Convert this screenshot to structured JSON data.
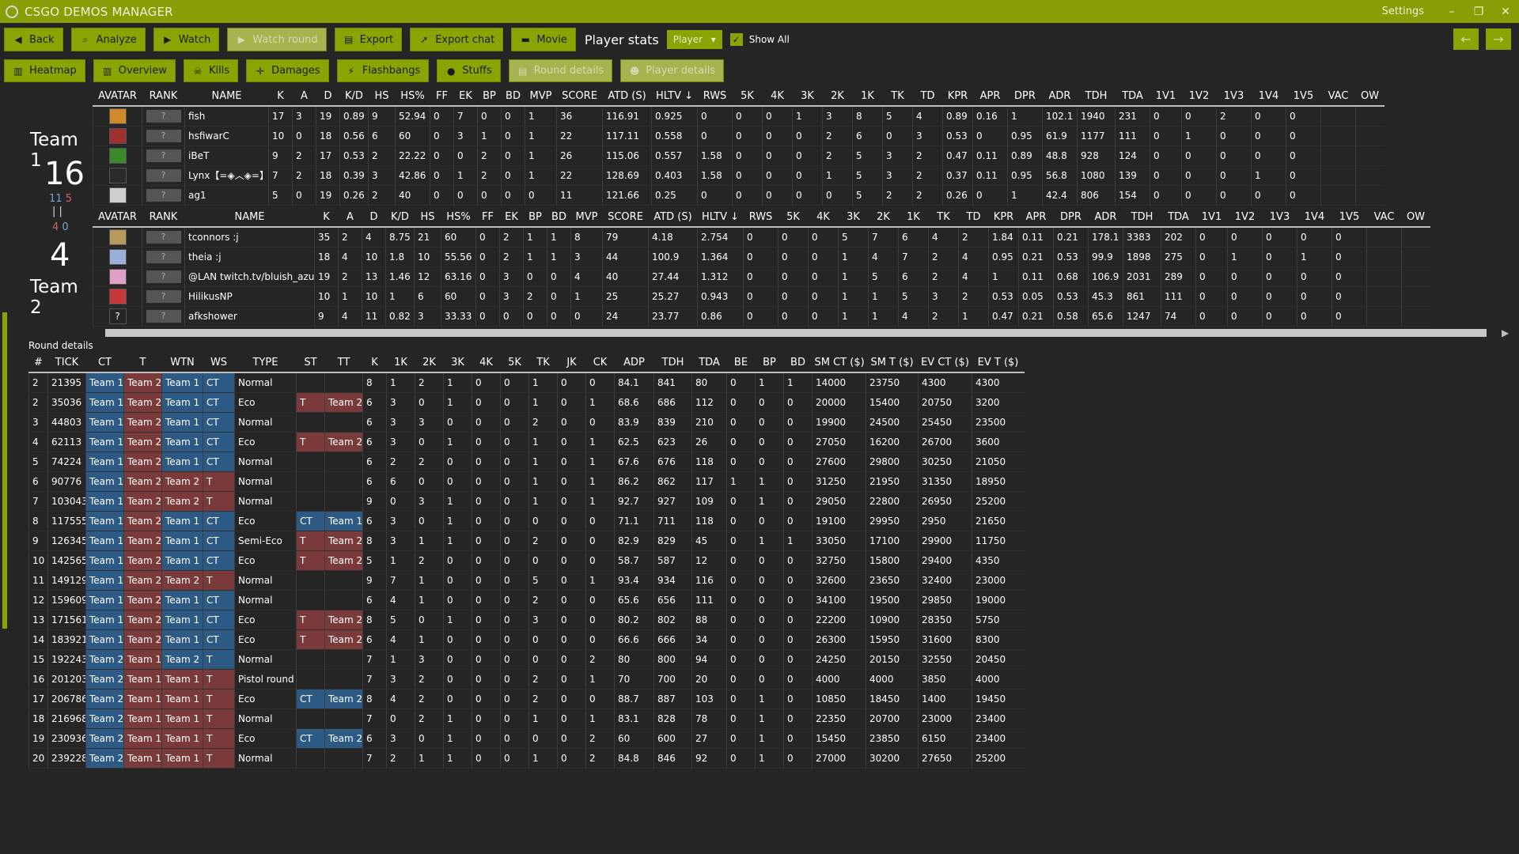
{
  "app": {
    "title": "CSGO DEMOS MANAGER",
    "settings": "Settings",
    "win_min": "–",
    "win_max": "❐",
    "win_close": "✕"
  },
  "toolbar1": {
    "back": "Back",
    "analyze": "Analyze",
    "watch": "Watch",
    "watch_round": "Watch round",
    "export": "Export",
    "export_chat": "Export chat",
    "movie": "Movie",
    "player_stats": "Player stats",
    "player_select": "Player",
    "show_all": "Show All"
  },
  "toolbar2": {
    "heatmap": "Heatmap",
    "overview": "Overview",
    "kills": "Kills",
    "damages": "Damages",
    "flashbangs": "Flashbangs",
    "stuffs": "Stuffs",
    "round_details": "Round details",
    "player_details": "Player details"
  },
  "team1": {
    "name": "Team 1",
    "score": "16",
    "half_a": "11",
    "half_b": "5",
    "half_c": "4",
    "half_d": "0"
  },
  "team2": {
    "name": "Team 2",
    "score": "4"
  },
  "player_headers": [
    "AVATAR",
    "RANK",
    "NAME",
    "K",
    "A",
    "D",
    "K/D",
    "HS",
    "HS%",
    "FF",
    "EK",
    "BP",
    "BD",
    "MVP",
    "SCORE",
    "ATD (S)",
    "HLTV ↓",
    "RWS",
    "5K",
    "4K",
    "3K",
    "2K",
    "1K",
    "TK",
    "TD",
    "KPR",
    "APR",
    "DPR",
    "ADR",
    "TDH",
    "TDA",
    "1V1",
    "1V2",
    "1V3",
    "1V4",
    "1V5",
    "VAC",
    "OW"
  ],
  "rank_placeholder": "?",
  "team1_players": [
    {
      "avatar_color": "#d08a2a",
      "cells": [
        "fish",
        "17",
        "3",
        "19",
        "0.89",
        "9",
        "52.94",
        "0",
        "7",
        "0",
        "0",
        "1",
        "36",
        "116.91",
        "0.925",
        "0",
        "0",
        "0",
        "1",
        "3",
        "8",
        "5",
        "4",
        "0.89",
        "0.16",
        "1",
        "102.1",
        "1940",
        "231",
        "0",
        "0",
        "2",
        "0",
        "0",
        "",
        ""
      ]
    },
    {
      "avatar_color": "#a03030",
      "cells": [
        "hsfiwarC",
        "10",
        "0",
        "18",
        "0.56",
        "6",
        "60",
        "0",
        "3",
        "1",
        "0",
        "1",
        "22",
        "117.11",
        "0.558",
        "0",
        "0",
        "0",
        "0",
        "2",
        "6",
        "0",
        "3",
        "0.53",
        "0",
        "0.95",
        "61.9",
        "1177",
        "111",
        "0",
        "1",
        "0",
        "0",
        "0",
        "",
        ""
      ]
    },
    {
      "avatar_color": "#3a8a2a",
      "cells": [
        "iBeT",
        "9",
        "2",
        "17",
        "0.53",
        "2",
        "22.22",
        "0",
        "0",
        "2",
        "0",
        "1",
        "26",
        "115.06",
        "0.557",
        "1.58",
        "0",
        "0",
        "0",
        "2",
        "5",
        "3",
        "2",
        "0.47",
        "0.11",
        "0.89",
        "48.8",
        "928",
        "124",
        "0",
        "0",
        "0",
        "0",
        "0",
        "",
        ""
      ]
    },
    {
      "avatar_color": "#2a2a2a",
      "cells": [
        "Lynx【=◈︿◈=】",
        "7",
        "2",
        "18",
        "0.39",
        "3",
        "42.86",
        "0",
        "1",
        "2",
        "0",
        "1",
        "22",
        "128.69",
        "0.403",
        "1.58",
        "0",
        "0",
        "0",
        "1",
        "5",
        "3",
        "2",
        "0.37",
        "0.11",
        "0.95",
        "56.8",
        "1080",
        "139",
        "0",
        "0",
        "0",
        "1",
        "0",
        "",
        ""
      ]
    },
    {
      "avatar_color": "#cfcfcf",
      "cells": [
        "ag1",
        "5",
        "0",
        "19",
        "0.26",
        "2",
        "40",
        "0",
        "0",
        "0",
        "0",
        "0",
        "11",
        "121.66",
        "0.25",
        "0",
        "0",
        "0",
        "0",
        "0",
        "5",
        "2",
        "2",
        "0.26",
        "0",
        "1",
        "42.4",
        "806",
        "154",
        "0",
        "0",
        "0",
        "0",
        "0",
        "",
        ""
      ]
    }
  ],
  "team2_players": [
    {
      "avatar_color": "#b89a5a",
      "cells": [
        "tconnors :j",
        "35",
        "2",
        "4",
        "8.75",
        "21",
        "60",
        "0",
        "2",
        "1",
        "1",
        "8",
        "79",
        "4.18",
        "2.754",
        "0",
        "0",
        "0",
        "5",
        "7",
        "6",
        "4",
        "2",
        "1.84",
        "0.11",
        "0.21",
        "178.1",
        "3383",
        "202",
        "0",
        "0",
        "0",
        "0",
        "0",
        "",
        ""
      ]
    },
    {
      "avatar_color": "#9ab0d8",
      "cells": [
        "theia :j",
        "18",
        "4",
        "10",
        "1.8",
        "10",
        "55.56",
        "0",
        "2",
        "1",
        "1",
        "3",
        "44",
        "100.9",
        "1.364",
        "0",
        "0",
        "0",
        "1",
        "4",
        "7",
        "2",
        "4",
        "0.95",
        "0.21",
        "0.53",
        "99.9",
        "1898",
        "275",
        "0",
        "1",
        "0",
        "1",
        "0",
        "",
        ""
      ]
    },
    {
      "avatar_color": "#e0a0c8",
      "cells": [
        "@LAN twitch.tv/bluish_azul",
        "19",
        "2",
        "13",
        "1.46",
        "12",
        "63.16",
        "0",
        "3",
        "0",
        "0",
        "4",
        "40",
        "27.44",
        "1.312",
        "0",
        "0",
        "0",
        "1",
        "5",
        "6",
        "2",
        "4",
        "1",
        "0.11",
        "0.68",
        "106.9",
        "2031",
        "289",
        "0",
        "0",
        "0",
        "0",
        "0",
        "",
        ""
      ]
    },
    {
      "avatar_color": "#c83838",
      "cells": [
        "HilikusNP",
        "10",
        "1",
        "10",
        "1",
        "6",
        "60",
        "0",
        "3",
        "2",
        "0",
        "1",
        "25",
        "25.27",
        "0.943",
        "0",
        "0",
        "0",
        "1",
        "1",
        "5",
        "3",
        "2",
        "0.53",
        "0.05",
        "0.53",
        "45.3",
        "861",
        "111",
        "0",
        "0",
        "0",
        "0",
        "0",
        "",
        ""
      ]
    },
    {
      "avatar_color": "#252526",
      "avatar_text": "?",
      "cells": [
        "afkshower",
        "9",
        "4",
        "11",
        "0.82",
        "3",
        "33.33",
        "0",
        "0",
        "0",
        "0",
        "0",
        "24",
        "23.77",
        "0.86",
        "0",
        "0",
        "0",
        "1",
        "1",
        "4",
        "2",
        "1",
        "0.47",
        "0.21",
        "0.58",
        "65.6",
        "1247",
        "74",
        "0",
        "0",
        "0",
        "0",
        "0",
        "",
        ""
      ]
    }
  ],
  "round_details_title": "Round details",
  "round_headers": [
    "#",
    "TICK",
    "CT",
    "T",
    "WTN",
    "WS",
    "TYPE",
    "ST",
    "TT",
    "K",
    "1K",
    "2K",
    "3K",
    "4K",
    "5K",
    "TK",
    "JK",
    "CK",
    "ADP",
    "TDH",
    "TDA",
    "BE",
    "BP",
    "BD",
    "SM CT ($)",
    "SM T ($)",
    "EV CT ($)",
    "EV T ($)"
  ],
  "rounds": [
    [
      "2",
      "21395",
      "Team 1",
      "Team 2",
      "Team 1",
      "CT",
      "Normal",
      "",
      "",
      "8",
      "1",
      "2",
      "1",
      "0",
      "0",
      "1",
      "0",
      "0",
      "84.1",
      "841",
      "80",
      "0",
      "1",
      "1",
      "14000",
      "23750",
      "4300",
      "4300"
    ],
    [
      "2",
      "35036",
      "Team 1",
      "Team 2",
      "Team 1",
      "CT",
      "Eco",
      "T",
      "Team 2",
      "6",
      "3",
      "0",
      "1",
      "0",
      "0",
      "1",
      "0",
      "1",
      "68.6",
      "686",
      "112",
      "0",
      "0",
      "0",
      "20000",
      "15400",
      "20750",
      "3200"
    ],
    [
      "3",
      "44803",
      "Team 1",
      "Team 2",
      "Team 1",
      "CT",
      "Normal",
      "",
      "",
      "6",
      "3",
      "3",
      "0",
      "0",
      "0",
      "2",
      "0",
      "0",
      "83.9",
      "839",
      "210",
      "0",
      "0",
      "0",
      "19900",
      "24500",
      "25450",
      "23500"
    ],
    [
      "4",
      "62113",
      "Team 1",
      "Team 2",
      "Team 1",
      "CT",
      "Eco",
      "T",
      "Team 2",
      "6",
      "3",
      "0",
      "1",
      "0",
      "0",
      "1",
      "0",
      "1",
      "62.5",
      "623",
      "26",
      "0",
      "0",
      "0",
      "27050",
      "16200",
      "26700",
      "3600"
    ],
    [
      "5",
      "74224",
      "Team 1",
      "Team 2",
      "Team 1",
      "CT",
      "Normal",
      "",
      "",
      "6",
      "2",
      "2",
      "0",
      "0",
      "0",
      "1",
      "0",
      "1",
      "67.6",
      "676",
      "118",
      "0",
      "0",
      "0",
      "27600",
      "29800",
      "30250",
      "21050"
    ],
    [
      "6",
      "90776",
      "Team 1",
      "Team 2",
      "Team 2",
      "T",
      "Normal",
      "",
      "",
      "6",
      "6",
      "0",
      "0",
      "0",
      "0",
      "1",
      "0",
      "1",
      "86.2",
      "862",
      "117",
      "1",
      "1",
      "0",
      "31250",
      "21950",
      "31350",
      "18950"
    ],
    [
      "7",
      "103043",
      "Team 1",
      "Team 2",
      "Team 2",
      "T",
      "Normal",
      "",
      "",
      "9",
      "0",
      "3",
      "1",
      "0",
      "0",
      "1",
      "0",
      "1",
      "92.7",
      "927",
      "109",
      "0",
      "1",
      "0",
      "29050",
      "22800",
      "26950",
      "25200"
    ],
    [
      "8",
      "117555",
      "Team 1",
      "Team 2",
      "Team 1",
      "CT",
      "Eco",
      "CT",
      "Team 1",
      "6",
      "3",
      "0",
      "1",
      "0",
      "0",
      "0",
      "0",
      "0",
      "71.1",
      "711",
      "118",
      "0",
      "0",
      "0",
      "19100",
      "29950",
      "2950",
      "21650"
    ],
    [
      "9",
      "126345",
      "Team 1",
      "Team 2",
      "Team 1",
      "CT",
      "Semi-Eco",
      "T",
      "Team 2",
      "8",
      "3",
      "1",
      "1",
      "0",
      "0",
      "2",
      "0",
      "0",
      "82.9",
      "829",
      "45",
      "0",
      "1",
      "1",
      "33050",
      "17100",
      "29900",
      "11750"
    ],
    [
      "10",
      "142565",
      "Team 1",
      "Team 2",
      "Team 1",
      "CT",
      "Eco",
      "T",
      "Team 2",
      "5",
      "1",
      "2",
      "0",
      "0",
      "0",
      "0",
      "0",
      "0",
      "58.7",
      "587",
      "12",
      "0",
      "0",
      "0",
      "32750",
      "15800",
      "29400",
      "4350"
    ],
    [
      "11",
      "149129",
      "Team 1",
      "Team 2",
      "Team 2",
      "T",
      "Normal",
      "",
      "",
      "9",
      "7",
      "1",
      "0",
      "0",
      "0",
      "5",
      "0",
      "1",
      "93.4",
      "934",
      "116",
      "0",
      "0",
      "0",
      "32600",
      "23650",
      "32400",
      "23000"
    ],
    [
      "12",
      "159609",
      "Team 1",
      "Team 2",
      "Team 1",
      "CT",
      "Normal",
      "",
      "",
      "6",
      "4",
      "1",
      "0",
      "0",
      "0",
      "2",
      "0",
      "0",
      "65.6",
      "656",
      "111",
      "0",
      "0",
      "0",
      "34100",
      "19500",
      "29850",
      "19000"
    ],
    [
      "13",
      "171561",
      "Team 1",
      "Team 2",
      "Team 1",
      "CT",
      "Eco",
      "T",
      "Team 2",
      "8",
      "5",
      "0",
      "1",
      "0",
      "0",
      "3",
      "0",
      "0",
      "80.2",
      "802",
      "88",
      "0",
      "0",
      "0",
      "22200",
      "10900",
      "28350",
      "5750"
    ],
    [
      "14",
      "183921",
      "Team 1",
      "Team 2",
      "Team 1",
      "CT",
      "Eco",
      "T",
      "Team 2",
      "6",
      "4",
      "1",
      "0",
      "0",
      "0",
      "0",
      "0",
      "0",
      "66.6",
      "666",
      "34",
      "0",
      "0",
      "0",
      "26300",
      "15950",
      "31600",
      "8300"
    ],
    [
      "15",
      "192243",
      "Team 2",
      "Team 1",
      "Team 2",
      "T",
      "Normal",
      "",
      "",
      "7",
      "1",
      "3",
      "0",
      "0",
      "0",
      "0",
      "0",
      "2",
      "80",
      "800",
      "94",
      "0",
      "0",
      "0",
      "24250",
      "20150",
      "32550",
      "20450"
    ],
    [
      "16",
      "201203",
      "Team 2",
      "Team 1",
      "Team 1",
      "T",
      "Pistol round",
      "",
      "",
      "7",
      "3",
      "2",
      "0",
      "0",
      "0",
      "2",
      "0",
      "1",
      "70",
      "700",
      "20",
      "0",
      "0",
      "0",
      "4000",
      "4000",
      "3850",
      "4000"
    ],
    [
      "17",
      "206786",
      "Team 2",
      "Team 1",
      "Team 1",
      "T",
      "Eco",
      "CT",
      "Team 2",
      "8",
      "4",
      "2",
      "0",
      "0",
      "0",
      "2",
      "0",
      "0",
      "88.7",
      "887",
      "103",
      "0",
      "1",
      "0",
      "10850",
      "18450",
      "1400",
      "19450"
    ],
    [
      "18",
      "216968",
      "Team 2",
      "Team 1",
      "Team 1",
      "T",
      "Normal",
      "",
      "",
      "7",
      "0",
      "2",
      "1",
      "0",
      "0",
      "1",
      "0",
      "1",
      "83.1",
      "828",
      "78",
      "0",
      "1",
      "0",
      "22350",
      "20700",
      "23000",
      "23400"
    ],
    [
      "19",
      "230936",
      "Team 2",
      "Team 1",
      "Team 1",
      "T",
      "Eco",
      "CT",
      "Team 2",
      "6",
      "3",
      "0",
      "1",
      "0",
      "0",
      "0",
      "0",
      "2",
      "60",
      "600",
      "27",
      "0",
      "1",
      "0",
      "15450",
      "23850",
      "6150",
      "23400"
    ],
    [
      "20",
      "239228",
      "Team 2",
      "Team 1",
      "Team 1",
      "T",
      "Normal",
      "",
      "",
      "7",
      "2",
      "1",
      "1",
      "0",
      "0",
      "1",
      "0",
      "2",
      "84.8",
      "846",
      "92",
      "0",
      "1",
      "0",
      "27000",
      "30200",
      "27650",
      "25200"
    ]
  ],
  "colors": {
    "accent": "#8aa503",
    "ct": "#2d5a84",
    "t": "#7b3a3a",
    "background": "#252526"
  },
  "icons": {
    "back": "arrow-left-icon",
    "analyze": "search-icon",
    "watch": "play-icon",
    "export": "export-icon",
    "movie": "film-icon",
    "heatmap": "map-icon",
    "kills": "skull-icon",
    "damages": "crosshair-icon",
    "flashbangs": "flash-icon",
    "stuffs": "grenade-icon"
  }
}
